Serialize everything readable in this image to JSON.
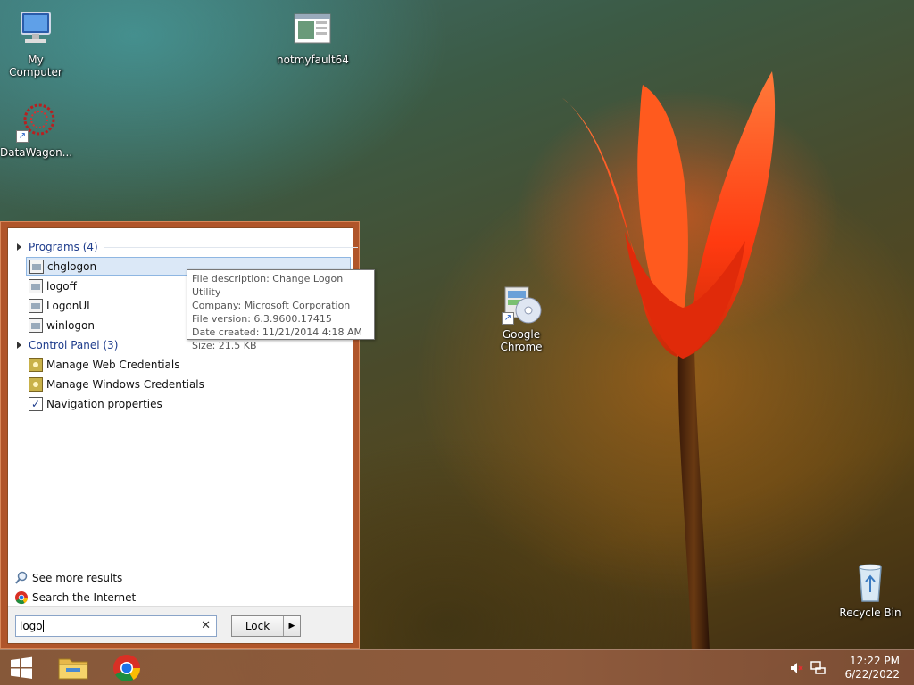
{
  "desktop": {
    "icons": [
      {
        "label": "My Computer"
      },
      {
        "label": "notmyfault64"
      },
      {
        "label": "DataWagon..."
      },
      {
        "label": "Google\nChrome"
      },
      {
        "label": "Recycle Bin"
      }
    ]
  },
  "start_search": {
    "groups": [
      {
        "title": "Programs (4)",
        "items": [
          "chglogon",
          "logoff",
          "LogonUI",
          "winlogon"
        ]
      },
      {
        "title": "Control Panel (3)",
        "items": [
          "Manage Web Credentials",
          "Manage Windows Credentials",
          "Navigation properties"
        ]
      }
    ],
    "see_more": "See more results",
    "search_internet": "Search the Internet",
    "query": "logo",
    "power_button_label": "Lock"
  },
  "tooltip": {
    "lines": [
      "File description: Change Logon Utility",
      "Company: Microsoft Corporation",
      "File version: 6.3.9600.17415",
      "Date created: 11/21/2014 4:18 AM",
      "Size: 21.5 KB"
    ]
  },
  "taskbar": {
    "time": "12:22 PM",
    "date": "6/22/2022"
  },
  "icons": {
    "start": "windows-logo-icon",
    "explorer": "file-explorer-icon",
    "chrome": "chrome-icon",
    "volume": "volume-muted-icon",
    "network": "network-icon"
  }
}
